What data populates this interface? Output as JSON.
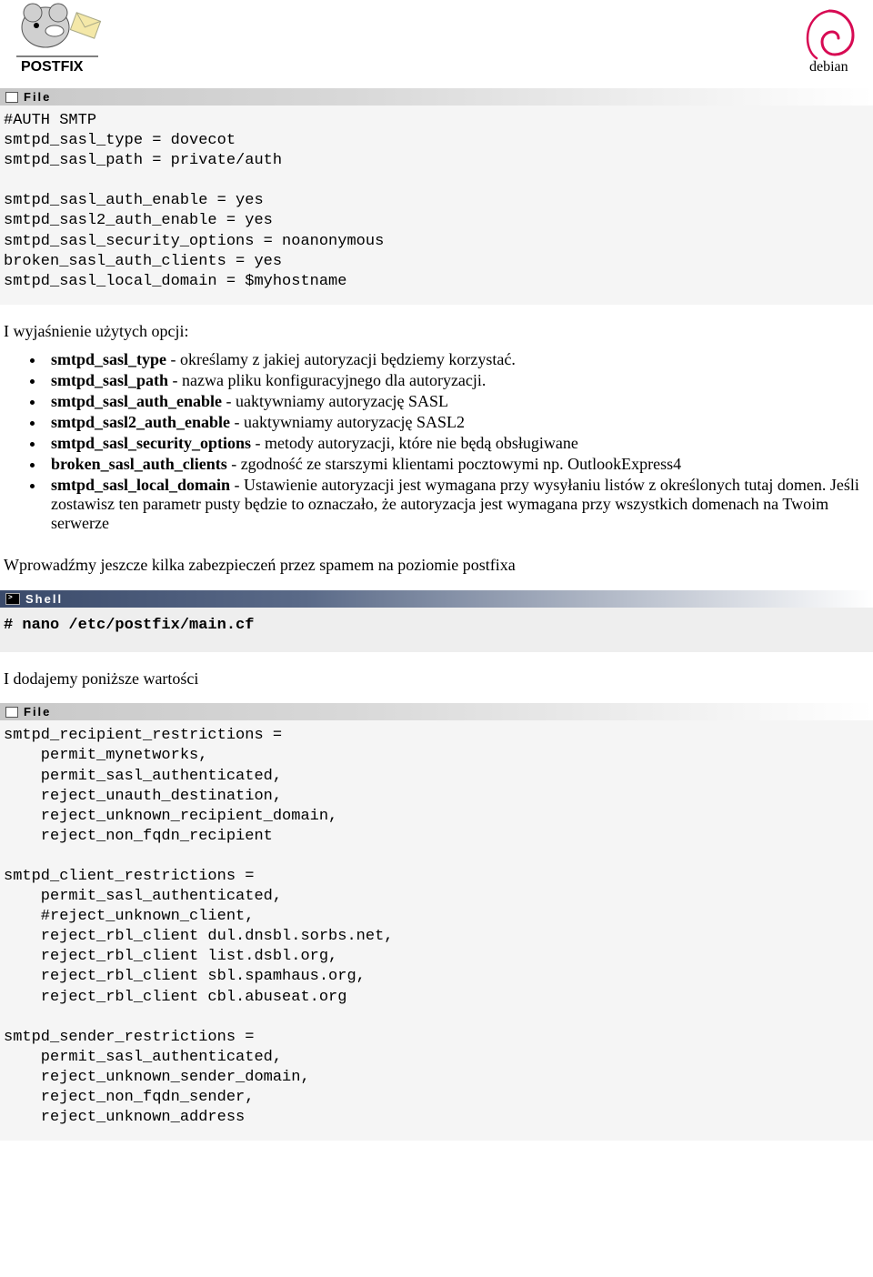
{
  "headers": {
    "file": "File",
    "shell": "Shell"
  },
  "code1": "#AUTH SMTP\nsmtpd_sasl_type = dovecot\nsmtpd_sasl_path = private/auth\n\nsmtpd_sasl_auth_enable = yes\nsmtpd_sasl2_auth_enable = yes\nsmtpd_sasl_security_options = noanonymous\nbroken_sasl_auth_clients = yes\nsmtpd_sasl_local_domain = $myhostname",
  "p1": "I wyjaśnienie użytych opcji:",
  "li": {
    "a_b": "smtpd_sasl_type",
    "a_t": " - określamy z jakiej autoryzacji będziemy korzystać.",
    "b_b": "smtpd_sasl_path",
    "b_t": " - nazwa pliku konfiguracyjnego dla autoryzacji.",
    "c_b": "smtpd_sasl_auth_enable",
    "c_t": " - uaktywniamy autoryzację SASL",
    "d_b": "smtpd_sasl2_auth_enable",
    "d_t": " - uaktywniamy autoryzację SASL2",
    "e_b": "smtpd_sasl_security_options",
    "e_t": " - metody autoryzacji, które nie będą obsługiwane",
    "f_b": "broken_sasl_auth_clients",
    "f_t": " - zgodność ze starszymi klientami pocztowymi np. OutlookExpress4",
    "g_b": "smtpd_sasl_local_domain",
    "g_t": " - Ustawienie autoryzacji jest wymagana przy wysyłaniu listów z określonych tutaj domen. Jeśli zostawisz ten parametr pusty będzie to oznaczało, że autoryzacja jest wymagana przy wszystkich domenach na Twoim serwerze"
  },
  "p2": "Wprowadźmy jeszcze kilka zabezpieczeń przez spamem na poziomie postfixa",
  "shell1": "# nano /etc/postfix/main.cf",
  "p3": "I dodajemy poniższe wartości",
  "code2": "smtpd_recipient_restrictions =\n    permit_mynetworks,\n    permit_sasl_authenticated,\n    reject_unauth_destination,\n    reject_unknown_recipient_domain,\n    reject_non_fqdn_recipient\n\nsmtpd_client_restrictions =\n    permit_sasl_authenticated,\n    #reject_unknown_client,\n    reject_rbl_client dul.dnsbl.sorbs.net,\n    reject_rbl_client list.dsbl.org,\n    reject_rbl_client sbl.spamhaus.org,\n    reject_rbl_client cbl.abuseat.org\n\nsmtpd_sender_restrictions =\n    permit_sasl_authenticated,\n    reject_unknown_sender_domain,\n    reject_non_fqdn_sender,\n    reject_unknown_address"
}
